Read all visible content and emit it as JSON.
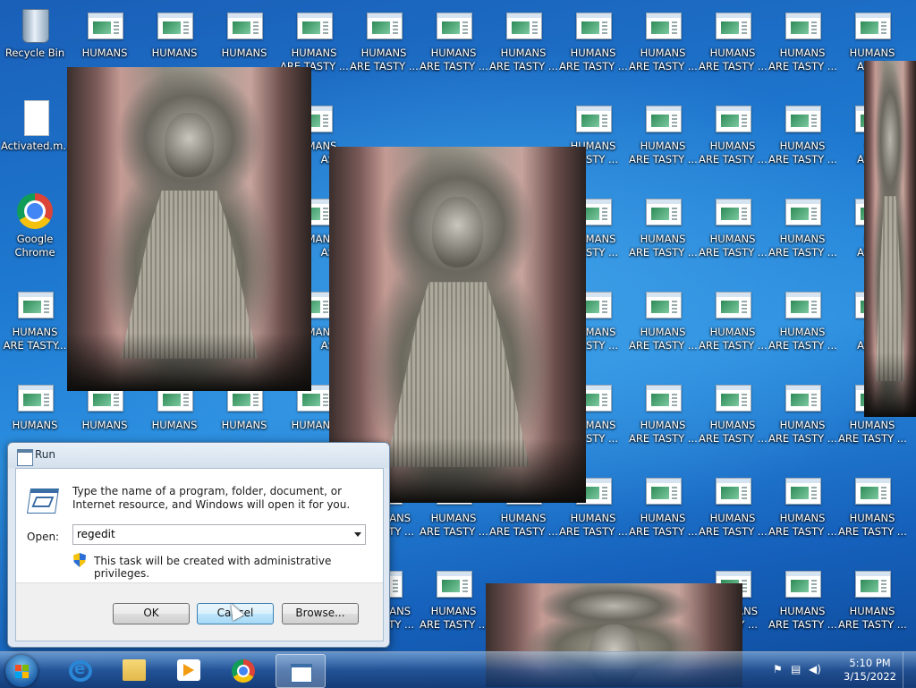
{
  "desktop": {
    "recycle_bin": "Recycle Bin",
    "activated_file": "Activated.m...",
    "chrome_line1": "Google",
    "chrome_line2": "Chrome",
    "humans": "HUMANS",
    "humans_tasty": "ARE TASTY ...",
    "humans_tasty_left": "ARE TASTY...",
    "humans_tasty_cut": "ARE T",
    "humans_cut": "HU",
    "tasty_cut1": "AST",
    "tasty_cut2": "STY ...",
    "tasty_cut3": "ASTY ...",
    "tasty_cut4": "TY ..."
  },
  "run_dialog": {
    "title": "Run",
    "description": "Type the name of a program, folder, document, or Internet resource, and Windows will open it for you.",
    "open_label": "Open:",
    "open_value": "regedit",
    "admin_note": "This task will be created with administrative privileges.",
    "ok": "OK",
    "cancel": "Cancel",
    "browse": "Browse..."
  },
  "taskbar": {
    "time": "5:10 PM",
    "date": "3/15/2022"
  }
}
